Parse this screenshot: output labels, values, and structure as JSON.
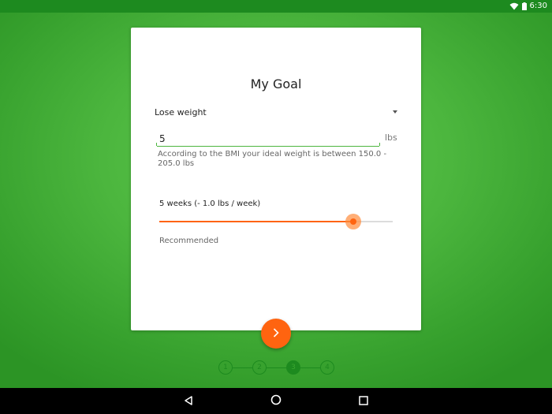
{
  "status_bar": {
    "time": "6:30",
    "wifi_icon": "wifi-icon",
    "battery_icon": "battery-icon"
  },
  "card": {
    "title": "My Goal",
    "goal_select": {
      "value": "Lose weight",
      "icon": "dropdown-arrow-icon"
    },
    "weight_input": {
      "value": "5",
      "unit": "lbs"
    },
    "bmi_helper": "According to the BMI your ideal weight is between 150.0 - 205.0 lbs",
    "duration": {
      "label": "5 weeks (- 1.0 lbs / week)",
      "slider_fraction": 0.83,
      "recommended": "Recommended"
    }
  },
  "next_button": {
    "icon": "chevron-right-icon"
  },
  "stepper": {
    "steps": [
      "1",
      "2",
      "3",
      "4"
    ],
    "current_index": 2
  },
  "nav_bar": {
    "back_icon": "back-triangle-icon",
    "home_icon": "home-circle-icon",
    "recents_icon": "recents-square-icon"
  },
  "colors": {
    "accent": "#ff6410",
    "primary_dark": "#1d8a1f",
    "primary": "#4cb63e"
  }
}
